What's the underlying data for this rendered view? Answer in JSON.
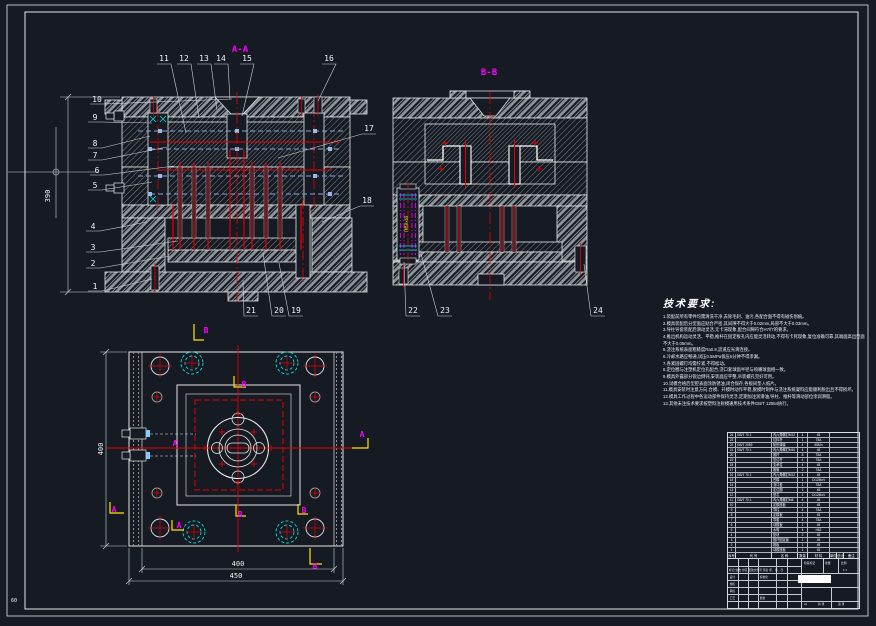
{
  "sheet": {
    "corner_mark": "60"
  },
  "sections": {
    "a_label": "A-A",
    "b_label": "B-B"
  },
  "callouts": [
    "1",
    "2",
    "3",
    "4",
    "5",
    "6",
    "7",
    "8",
    "9",
    "10",
    "11",
    "12",
    "13",
    "14",
    "15",
    "16",
    "17",
    "18",
    "19",
    "20",
    "21",
    "22",
    "23",
    "24"
  ],
  "plan": {
    "letter_a": "A",
    "letter_b": "B"
  },
  "dimensions": {
    "overall_height": "390",
    "inner_width": "400",
    "outer_width": "450",
    "side_height": "400"
  },
  "spring_tag": "TM50×60",
  "tech_requirements": {
    "title": "技术要求:",
    "items": [
      "1.装配前所有零件均需清洗干净,去除毛刺、油污,各配合面不得有碰伤划痕。",
      "2.模具装配后分型面应贴合严密,其间隙不得大于0.02mm,局部不大于0.03mm。",
      "3.导柱导套装配后滑动灵活,无卡滞现象,配合间隙符合H7/f7的要求。",
      "4.推出机构运动灵活、平稳,推杆在固定板孔内应能灵活转动,不得有卡死现象,复位准确可靠,其端面高出型面不大于0.05mm。",
      "5.浇注系统表面粗糙度Ra0.8,流道应光滑连接。",
      "6.冷却水路应畅通,试压0.5MPa保压5分钟不得渗漏。",
      "7.各紧固螺钉均需拧紧,不得松动。",
      "8.定位圈与注塑机定位孔配合,浇口套球面半径与喷嘴球面相一致。",
      "9.模具外露部分锐边倒钝,安装面应平整,吊装螺孔完好可用。",
      "10.试模合格后型腔表面涂防锈油,闭合保存,各板间垫入纸片。",
      "11.模具安装时注意方向,合模、开模时动作平稳,脱模时制件与浇注系统凝料应能顺利脱出且不得损坏。",
      "12.模具工作过程中各运动部件保持灵活,定期加注润滑油,导柱、推杆等滑动部位涂润滑脂。",
      "13.其他未注技术要求按塑料注射模通用技术条件GB/T 12554执行。"
    ]
  },
  "bom": {
    "headers": [
      "序号",
      "代  号",
      "名  称",
      "数量",
      "材  料",
      "单件",
      "总计",
      "备注"
    ],
    "rows": [
      {
        "no": "24",
        "code": "GB/T 70.1",
        "name": "内六角螺钉M12",
        "qty": "4",
        "mat": "45",
        "remark": ""
      },
      {
        "no": "23",
        "code": "",
        "name": "拉料杆",
        "qty": "1",
        "mat": "T8A",
        "remark": ""
      },
      {
        "no": "22",
        "code": "GB/T 2089",
        "name": "矩形弹簧",
        "qty": "4",
        "mat": "65Mn",
        "remark": ""
      },
      {
        "no": "21",
        "code": "GB/T 70.1",
        "name": "内六角螺钉M10",
        "qty": "4",
        "mat": "45",
        "remark": ""
      },
      {
        "no": "20",
        "code": "",
        "name": "推杆",
        "qty": "8",
        "mat": "T8A",
        "remark": ""
      },
      {
        "no": "19",
        "code": "",
        "name": "复位杆",
        "qty": "4",
        "mat": "T8A",
        "remark": ""
      },
      {
        "no": "18",
        "code": "",
        "name": "支承柱",
        "qty": "4",
        "mat": "45",
        "remark": ""
      },
      {
        "no": "17",
        "code": "",
        "name": "推管",
        "qty": "2",
        "mat": "T8A",
        "remark": ""
      },
      {
        "no": "16",
        "code": "GB/T 70.1",
        "name": "内六角螺钉M12",
        "qty": "4",
        "mat": "45",
        "remark": ""
      },
      {
        "no": "15",
        "code": "",
        "name": "凹模",
        "qty": "1",
        "mat": "Cr12MoV",
        "remark": ""
      },
      {
        "no": "14",
        "code": "",
        "name": "浇口套",
        "qty": "1",
        "mat": "T8A",
        "remark": ""
      },
      {
        "no": "13",
        "code": "",
        "name": "定位圈",
        "qty": "1",
        "mat": "45",
        "remark": ""
      },
      {
        "no": "12",
        "code": "",
        "name": "型芯",
        "qty": "1",
        "mat": "Cr12MoV",
        "remark": ""
      },
      {
        "no": "11",
        "code": "GB/T 70.1",
        "name": "内六角螺钉M8",
        "qty": "4",
        "mat": "45",
        "remark": ""
      },
      {
        "no": "10",
        "code": "",
        "name": "定模座板",
        "qty": "1",
        "mat": "45",
        "remark": ""
      },
      {
        "no": "9",
        "code": "",
        "name": "导柱",
        "qty": "4",
        "mat": "T8A",
        "remark": ""
      },
      {
        "no": "8",
        "code": "",
        "name": "定模板",
        "qty": "1",
        "mat": "45",
        "remark": ""
      },
      {
        "no": "7",
        "code": "",
        "name": "导套",
        "qty": "4",
        "mat": "T8A",
        "remark": ""
      },
      {
        "no": "6",
        "code": "",
        "name": "动模板",
        "qty": "1",
        "mat": "45",
        "remark": ""
      },
      {
        "no": "5",
        "code": "",
        "name": "水嘴",
        "qty": "4",
        "mat": "H62",
        "remark": ""
      },
      {
        "no": "4",
        "code": "",
        "name": "垫块",
        "qty": "2",
        "mat": "45",
        "remark": ""
      },
      {
        "no": "3",
        "code": "",
        "name": "推杆固定板",
        "qty": "1",
        "mat": "45",
        "remark": ""
      },
      {
        "no": "2",
        "code": "",
        "name": "推板",
        "qty": "1",
        "mat": "45",
        "remark": ""
      },
      {
        "no": "1",
        "code": "",
        "name": "动模座板",
        "qty": "1",
        "mat": "45",
        "remark": ""
      }
    ]
  },
  "title_block": {
    "marks_row": "标记 处数 分区 更改文件号 签名 年、月、日",
    "design": "设计",
    "check": "校核",
    "audit": "审核",
    "process": "工艺",
    "standard": "标准化",
    "approve": "批准",
    "stage": "阶段标记",
    "weight": "重量",
    "scale": "比例",
    "scale_value": "1:1",
    "sheet_size": "A1",
    "total": "共 张",
    "page": "第 张"
  }
}
